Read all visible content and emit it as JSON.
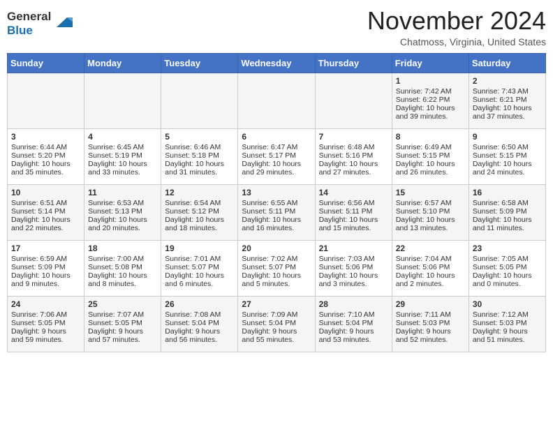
{
  "header": {
    "logo_line1": "General",
    "logo_line2": "Blue",
    "month_year": "November 2024",
    "location": "Chatmoss, Virginia, United States"
  },
  "days_of_week": [
    "Sunday",
    "Monday",
    "Tuesday",
    "Wednesday",
    "Thursday",
    "Friday",
    "Saturday"
  ],
  "weeks": [
    [
      {
        "day": "",
        "info": ""
      },
      {
        "day": "",
        "info": ""
      },
      {
        "day": "",
        "info": ""
      },
      {
        "day": "",
        "info": ""
      },
      {
        "day": "",
        "info": ""
      },
      {
        "day": "1",
        "info": "Sunrise: 7:42 AM\nSunset: 6:22 PM\nDaylight: 10 hours and 39 minutes."
      },
      {
        "day": "2",
        "info": "Sunrise: 7:43 AM\nSunset: 6:21 PM\nDaylight: 10 hours and 37 minutes."
      }
    ],
    [
      {
        "day": "3",
        "info": "Sunrise: 6:44 AM\nSunset: 5:20 PM\nDaylight: 10 hours and 35 minutes."
      },
      {
        "day": "4",
        "info": "Sunrise: 6:45 AM\nSunset: 5:19 PM\nDaylight: 10 hours and 33 minutes."
      },
      {
        "day": "5",
        "info": "Sunrise: 6:46 AM\nSunset: 5:18 PM\nDaylight: 10 hours and 31 minutes."
      },
      {
        "day": "6",
        "info": "Sunrise: 6:47 AM\nSunset: 5:17 PM\nDaylight: 10 hours and 29 minutes."
      },
      {
        "day": "7",
        "info": "Sunrise: 6:48 AM\nSunset: 5:16 PM\nDaylight: 10 hours and 27 minutes."
      },
      {
        "day": "8",
        "info": "Sunrise: 6:49 AM\nSunset: 5:15 PM\nDaylight: 10 hours and 26 minutes."
      },
      {
        "day": "9",
        "info": "Sunrise: 6:50 AM\nSunset: 5:15 PM\nDaylight: 10 hours and 24 minutes."
      }
    ],
    [
      {
        "day": "10",
        "info": "Sunrise: 6:51 AM\nSunset: 5:14 PM\nDaylight: 10 hours and 22 minutes."
      },
      {
        "day": "11",
        "info": "Sunrise: 6:53 AM\nSunset: 5:13 PM\nDaylight: 10 hours and 20 minutes."
      },
      {
        "day": "12",
        "info": "Sunrise: 6:54 AM\nSunset: 5:12 PM\nDaylight: 10 hours and 18 minutes."
      },
      {
        "day": "13",
        "info": "Sunrise: 6:55 AM\nSunset: 5:11 PM\nDaylight: 10 hours and 16 minutes."
      },
      {
        "day": "14",
        "info": "Sunrise: 6:56 AM\nSunset: 5:11 PM\nDaylight: 10 hours and 15 minutes."
      },
      {
        "day": "15",
        "info": "Sunrise: 6:57 AM\nSunset: 5:10 PM\nDaylight: 10 hours and 13 minutes."
      },
      {
        "day": "16",
        "info": "Sunrise: 6:58 AM\nSunset: 5:09 PM\nDaylight: 10 hours and 11 minutes."
      }
    ],
    [
      {
        "day": "17",
        "info": "Sunrise: 6:59 AM\nSunset: 5:09 PM\nDaylight: 10 hours and 9 minutes."
      },
      {
        "day": "18",
        "info": "Sunrise: 7:00 AM\nSunset: 5:08 PM\nDaylight: 10 hours and 8 minutes."
      },
      {
        "day": "19",
        "info": "Sunrise: 7:01 AM\nSunset: 5:07 PM\nDaylight: 10 hours and 6 minutes."
      },
      {
        "day": "20",
        "info": "Sunrise: 7:02 AM\nSunset: 5:07 PM\nDaylight: 10 hours and 5 minutes."
      },
      {
        "day": "21",
        "info": "Sunrise: 7:03 AM\nSunset: 5:06 PM\nDaylight: 10 hours and 3 minutes."
      },
      {
        "day": "22",
        "info": "Sunrise: 7:04 AM\nSunset: 5:06 PM\nDaylight: 10 hours and 2 minutes."
      },
      {
        "day": "23",
        "info": "Sunrise: 7:05 AM\nSunset: 5:05 PM\nDaylight: 10 hours and 0 minutes."
      }
    ],
    [
      {
        "day": "24",
        "info": "Sunrise: 7:06 AM\nSunset: 5:05 PM\nDaylight: 9 hours and 59 minutes."
      },
      {
        "day": "25",
        "info": "Sunrise: 7:07 AM\nSunset: 5:05 PM\nDaylight: 9 hours and 57 minutes."
      },
      {
        "day": "26",
        "info": "Sunrise: 7:08 AM\nSunset: 5:04 PM\nDaylight: 9 hours and 56 minutes."
      },
      {
        "day": "27",
        "info": "Sunrise: 7:09 AM\nSunset: 5:04 PM\nDaylight: 9 hours and 55 minutes."
      },
      {
        "day": "28",
        "info": "Sunrise: 7:10 AM\nSunset: 5:04 PM\nDaylight: 9 hours and 53 minutes."
      },
      {
        "day": "29",
        "info": "Sunrise: 7:11 AM\nSunset: 5:03 PM\nDaylight: 9 hours and 52 minutes."
      },
      {
        "day": "30",
        "info": "Sunrise: 7:12 AM\nSunset: 5:03 PM\nDaylight: 9 hours and 51 minutes."
      }
    ]
  ]
}
